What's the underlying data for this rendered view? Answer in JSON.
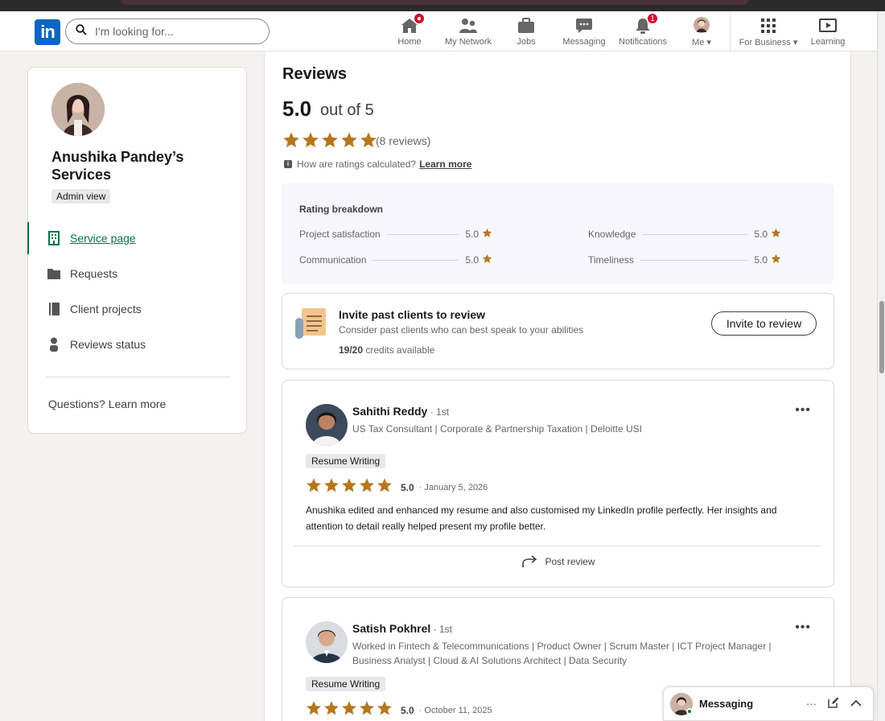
{
  "nav": {
    "logo_text": "in",
    "search_placeholder": "I'm looking for...",
    "items": [
      {
        "label": "Home",
        "badge": ""
      },
      {
        "label": "My Network",
        "badge": ""
      },
      {
        "label": "Jobs",
        "badge": ""
      },
      {
        "label": "Messaging",
        "badge": ""
      },
      {
        "label": "Notifications",
        "badge": "1"
      },
      {
        "label": "Me",
        "badge": ""
      },
      {
        "label": "For Business",
        "badge": ""
      },
      {
        "label": "Learning",
        "badge": ""
      }
    ]
  },
  "sidebar": {
    "title": "Anushika Pandey’s Services",
    "admin_chip": "Admin view",
    "items": [
      {
        "label": "Service page"
      },
      {
        "label": "Requests"
      },
      {
        "label": "Client projects"
      },
      {
        "label": "Reviews status"
      }
    ],
    "questions": "Questions? Learn more"
  },
  "reviews": {
    "title": "Reviews",
    "score": "5.0",
    "out_of": "out of 5",
    "stars": 5,
    "count": "(8 reviews)",
    "how_text": "How are ratings calculated?",
    "learn_more": "Learn more",
    "breakdown": {
      "title": "Rating breakdown",
      "rows": [
        {
          "label": "Project satisfaction",
          "value": "5.0"
        },
        {
          "label": "Knowledge",
          "value": "5.0"
        },
        {
          "label": "Communication",
          "value": "5.0"
        },
        {
          "label": "Timeliness",
          "value": "5.0"
        }
      ]
    }
  },
  "invite": {
    "title": "Invite past clients to review",
    "subtitle": "Consider past clients who can best speak to your abilities",
    "credits_count": "19/20",
    "credits_text": " credits available",
    "button": "Invite to review"
  },
  "review_list": [
    {
      "name": "Sahithi Reddy",
      "degree": " · 1st",
      "headline": "US Tax Consultant | Corporate & Partnership Taxation | Deloitte USI",
      "tag": "Resume Writing",
      "score": "5.0",
      "date": "· January 5, 2026",
      "text": "Anushika edited and enhanced my resume and also customised my LinkedIn profile perfectly. Her insights and attention to detail really helped present my profile better.",
      "post": "Post review"
    },
    {
      "name": "Satish Pokhrel",
      "degree": " · 1st",
      "headline": "Worked in Fintech & Telecommunications | Product Owner | Scrum Master | ICT Project Manager | Business Analyst | Cloud & AI Solutions Architect | Data Security",
      "tag": "Resume Writing",
      "score": "5.0",
      "date": "· October 11, 2025"
    }
  ],
  "dock": {
    "label": "Messaging",
    "more": "···"
  },
  "colors": {
    "star": "#b5771e",
    "brand": "#0a66c2",
    "active_green": "#057642",
    "badge_red": "#cb112d"
  }
}
